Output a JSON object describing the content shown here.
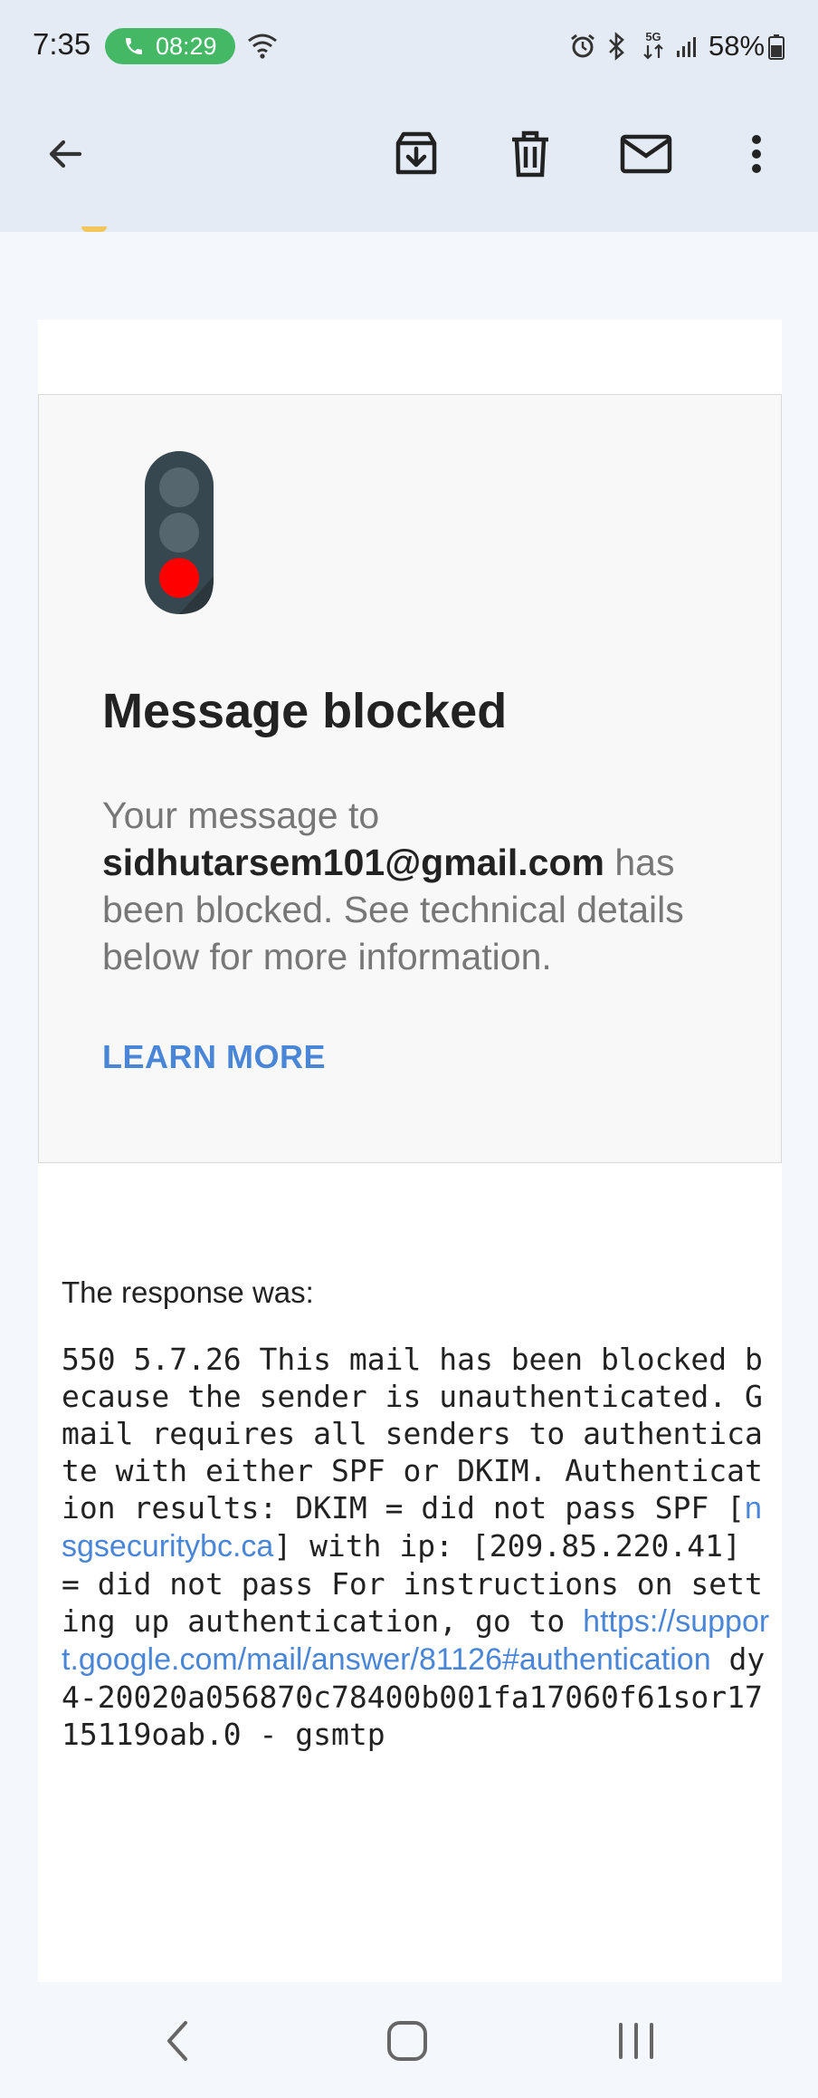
{
  "status_bar": {
    "time": "7:35",
    "call_duration": "08:29",
    "battery_percent": "58%",
    "network_label": "5G"
  },
  "toolbar": {
    "icons": [
      "back-arrow-icon",
      "archive-icon",
      "trash-icon",
      "mail-icon",
      "more-vert-icon"
    ]
  },
  "email": {
    "notice": {
      "title": "Message blocked",
      "message_prefix": "Your message to ",
      "recipient": "sidhutarsem101@gmail.com",
      "message_suffix": " has been blocked. See technical details below for more information.",
      "learn_more_label": "LEARN MORE"
    },
    "response_label": "The response was:",
    "response": {
      "text_1": "550 5.7.26 This mail has been blocked because the sender is unauthenticated. Gmail requires all senders to authenticate with either SPF or DKIM. Authentication results: DKIM = did not pass SPF [",
      "domain_link": "nsgsecuritybc.ca",
      "text_2": "] with ip: [209.85.220.41] = did not pass For instructions on setting up authentication, go to ",
      "help_link": "https://support.google.com/mail/answer/81126#authentication",
      "text_3": " dy4-20020a056870c78400b001fa17060f61sor1715119oab.0 - gsmtp"
    }
  },
  "colors": {
    "toolbar_bg": "#e5ebf4",
    "link": "#4a86d7",
    "call_pill": "#45b866",
    "traffic_red": "#ff0000"
  }
}
